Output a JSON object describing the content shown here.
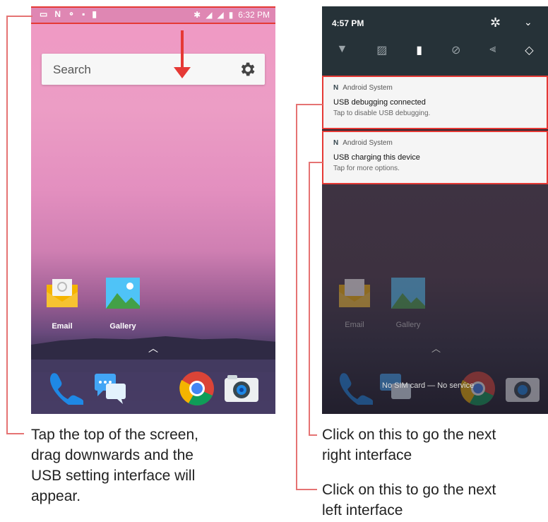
{
  "left_phone": {
    "status_time": "6:32 PM",
    "search_placeholder": "Search",
    "apps": [
      {
        "label": "Email"
      },
      {
        "label": "Gallery"
      }
    ],
    "dock_icons": [
      "phone-icon",
      "messaging-icon",
      "chrome-icon",
      "camera-icon"
    ]
  },
  "right_phone": {
    "status_time": "4:57 PM",
    "quick_settings_icons": [
      "wifi-icon",
      "no-sim-icon",
      "battery-icon",
      "do-not-disturb-icon",
      "flashlight-icon",
      "auto-rotate-icon"
    ],
    "notifications": [
      {
        "app": "Android System",
        "title": "USB debugging connected",
        "subtitle": "Tap to disable USB debugging."
      },
      {
        "app": "Android System",
        "title": "USB charging this device",
        "subtitle": "Tap for more options."
      }
    ],
    "apps": [
      {
        "label": "Email"
      },
      {
        "label": "Gallery"
      }
    ],
    "no_sim_text": "No SIM card — No service"
  },
  "captions": {
    "left": [
      "Tap the top of the screen,",
      "drag downwards and the",
      "USB setting interface will",
      "appear."
    ],
    "right_1": [
      "Click on this to go the next",
      "right interface"
    ],
    "right_2": [
      "Click on this to go the next",
      "left interface"
    ]
  },
  "colors": {
    "accent": "#e53935"
  }
}
